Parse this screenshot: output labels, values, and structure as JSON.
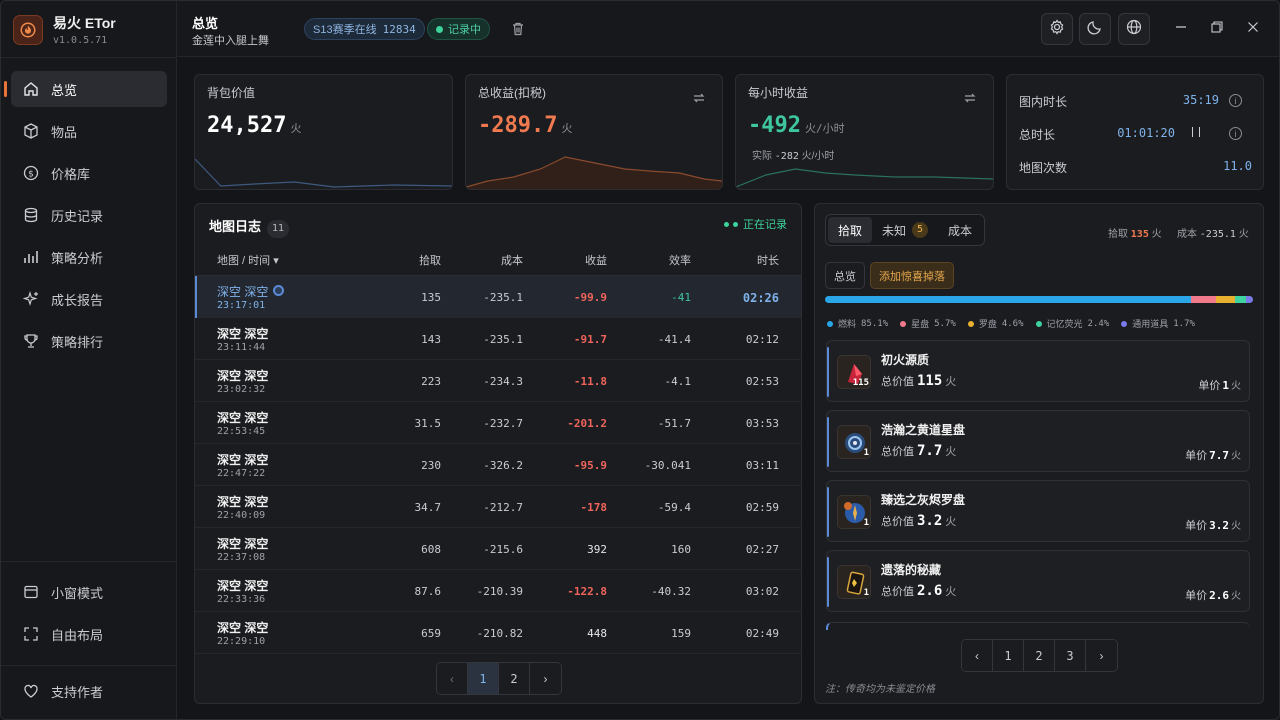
{
  "app": {
    "name": "易火 ETor",
    "version": "v1.0.5.71"
  },
  "nav": {
    "items": [
      {
        "label": "总览",
        "icon": "home-icon"
      },
      {
        "label": "物品",
        "icon": "box-icon"
      },
      {
        "label": "价格库",
        "icon": "dollar-icon"
      },
      {
        "label": "历史记录",
        "icon": "database-icon"
      },
      {
        "label": "策略分析",
        "icon": "bar-chart-icon"
      },
      {
        "label": "成长报告",
        "icon": "sparkle-icon"
      },
      {
        "label": "策略排行",
        "icon": "trophy-icon"
      }
    ],
    "bottom": [
      {
        "label": "小窗模式",
        "icon": "window-icon"
      },
      {
        "label": "自由布局",
        "icon": "expand-icon"
      }
    ],
    "support": "支持作者"
  },
  "header": {
    "title": "总览",
    "subtitle": "金莲中入腿上舞",
    "season_label": "S13赛季在线",
    "season_count": "12834",
    "recording": "记录中"
  },
  "cards": {
    "bag": {
      "label": "背包价值",
      "value": "24,527",
      "unit": "火"
    },
    "total": {
      "label": "总收益(扣税)",
      "value": "-289.7",
      "unit": "火"
    },
    "hourly": {
      "label": "每小时收益",
      "value": "-492",
      "unit": "火/小时",
      "actual_label": "实际",
      "actual_value": "-282",
      "actual_unit": "火/小时"
    },
    "time": {
      "in_map_label": "图内时长",
      "in_map": "35:19",
      "total_label": "总时长",
      "total": "01:01:20",
      "maps_label": "地图次数",
      "maps": "11.0"
    }
  },
  "maplog": {
    "title": "地图日志",
    "count": "11",
    "live": "正在记录",
    "columns": [
      "地图 / 时间",
      "拾取",
      "成本",
      "收益",
      "效率",
      "时长"
    ],
    "rows": [
      {
        "name": "深空 深空",
        "time": "23:17:01",
        "pick": "135",
        "cost": "-235.1",
        "profit": "-99.9",
        "eff": "-41",
        "dur": "02:26"
      },
      {
        "name": "深空 深空",
        "time": "23:11:44",
        "pick": "143",
        "cost": "-235.1",
        "profit": "-91.7",
        "eff": "-41.4",
        "dur": "02:12"
      },
      {
        "name": "深空 深空",
        "time": "23:02:32",
        "pick": "223",
        "cost": "-234.3",
        "profit": "-11.8",
        "eff": "-4.1",
        "dur": "02:53"
      },
      {
        "name": "深空 深空",
        "time": "22:53:45",
        "pick": "31.5",
        "cost": "-232.7",
        "profit": "-201.2",
        "eff": "-51.7",
        "dur": "03:53"
      },
      {
        "name": "深空 深空",
        "time": "22:47:22",
        "pick": "230",
        "cost": "-326.2",
        "profit": "-95.9",
        "eff": "-30.041",
        "dur": "03:11"
      },
      {
        "name": "深空 深空",
        "time": "22:40:09",
        "pick": "34.7",
        "cost": "-212.7",
        "profit": "-178",
        "eff": "-59.4",
        "dur": "02:59"
      },
      {
        "name": "深空 深空",
        "time": "22:37:08",
        "pick": "608",
        "cost": "-215.6",
        "profit": "392",
        "eff": "160",
        "dur": "02:27"
      },
      {
        "name": "深空 深空",
        "time": "22:33:36",
        "pick": "87.6",
        "cost": "-210.39",
        "profit": "-122.8",
        "eff": "-40.32",
        "dur": "03:02"
      },
      {
        "name": "深空 深空",
        "time": "22:29:10",
        "pick": "659",
        "cost": "-210.82",
        "profit": "448",
        "eff": "159",
        "dur": "02:49"
      }
    ],
    "pages": [
      "1",
      "2"
    ]
  },
  "drops": {
    "tabs": [
      "拾取",
      "未知",
      "成本"
    ],
    "unknown_count": "5",
    "pick_label": "拾取",
    "pick_value": "135",
    "cost_label": "成本",
    "cost_value": "-235.1",
    "unit": "火",
    "btn_overview": "总览",
    "btn_add": "添加惊喜掉落",
    "shares": [
      {
        "name": "燃料",
        "pct": "85.1%",
        "color": "#2aa6e8",
        "value": 85.1
      },
      {
        "name": "星盘",
        "pct": "5.7%",
        "color": "#f07a8a",
        "value": 5.7
      },
      {
        "name": "罗盘",
        "pct": "4.6%",
        "color": "#e8b030",
        "value": 4.6
      },
      {
        "name": "记忆荧光",
        "pct": "2.4%",
        "color": "#3ed3a0",
        "value": 2.4
      },
      {
        "name": "通用道具",
        "pct": "1.7%",
        "color": "#7a7ae8",
        "value": 1.7
      }
    ],
    "total_label": "总价值",
    "unit_label": "单价",
    "items": [
      {
        "name": "初火源质",
        "qty": "115",
        "total": "115",
        "unit_price": "1"
      },
      {
        "name": "浩瀚之黄道星盘",
        "qty": "1",
        "total": "7.7",
        "unit_price": "7.7"
      },
      {
        "name": "臻选之灰烬罗盘",
        "qty": "1",
        "total": "3.2",
        "unit_price": "3.2"
      },
      {
        "name": "遗落的秘藏",
        "qty": "1",
        "total": "2.6",
        "unit_price": "2.6"
      }
    ],
    "pages": [
      "1",
      "2",
      "3"
    ],
    "note": "注：传奇均为未鉴定价格"
  }
}
